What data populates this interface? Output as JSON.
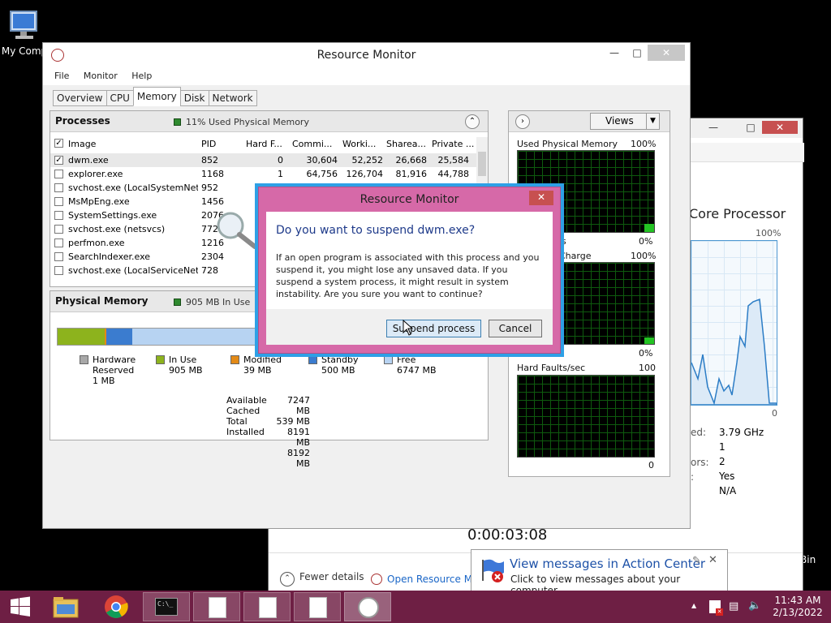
{
  "desktop": {
    "computer_icon_label": "My Comp",
    "bin_label": "Bin"
  },
  "task_manager": {
    "heading": "Core Processor",
    "graph_max": "100%",
    "graph_min": "0",
    "stats_labels": [
      "ed:",
      "ors:",
      ":",
      ""
    ],
    "stats_values": [
      "3.79 GHz",
      "1",
      "2",
      "Yes",
      "N/A"
    ],
    "uptime": "0:00:03:08",
    "fewer_details": "Fewer details",
    "open_resmon": "Open Resource Mo"
  },
  "resource_monitor": {
    "title": "Resource Monitor",
    "menu": [
      "File",
      "Monitor",
      "Help"
    ],
    "tabs": [
      "Overview",
      "CPU",
      "Memory",
      "Disk",
      "Network"
    ],
    "active_tab": "Memory",
    "processes": {
      "title": "Processes",
      "status": "11% Used Physical Memory",
      "columns": [
        "Image",
        "PID",
        "Hard F...",
        "Commi...",
        "Worki...",
        "Sharea...",
        "Private ..."
      ],
      "rows": [
        {
          "checked": true,
          "image": "dwm.exe",
          "pid": "852",
          "hard": "0",
          "commit": "30,604",
          "working": "52,252",
          "shareable": "26,668",
          "private": "25,584"
        },
        {
          "checked": false,
          "image": "explorer.exe",
          "pid": "1168",
          "hard": "1",
          "commit": "64,756",
          "working": "126,704",
          "shareable": "81,916",
          "private": "44,788"
        },
        {
          "checked": false,
          "image": "svchost.exe (LocalSystemNet...",
          "pid": "952"
        },
        {
          "checked": false,
          "image": "MsMpEng.exe",
          "pid": "1456"
        },
        {
          "checked": false,
          "image": "SystemSettings.exe",
          "pid": "2076"
        },
        {
          "checked": false,
          "image": "svchost.exe (netsvcs)",
          "pid": "772"
        },
        {
          "checked": false,
          "image": "perfmon.exe",
          "pid": "1216"
        },
        {
          "checked": false,
          "image": "SearchIndexer.exe",
          "pid": "2304"
        },
        {
          "checked": false,
          "image": "svchost.exe (LocalServiceNet...",
          "pid": "728"
        }
      ]
    },
    "physical_memory": {
      "title": "Physical Memory",
      "status": "905 MB In Use",
      "legend": [
        {
          "label": "Hardware",
          "label2": "Reserved",
          "value": "1 MB",
          "color": "#a8a8a8"
        },
        {
          "label": "In Use",
          "value": "905 MB",
          "color": "#8db31d"
        },
        {
          "label": "Modified",
          "value": "39 MB",
          "color": "#e38a16"
        },
        {
          "label": "Standby",
          "value": "500 MB",
          "color": "#3b7ccf"
        },
        {
          "label": "Free",
          "value": "6747 MB",
          "color": "#b7d3f2"
        }
      ],
      "totals_labels": [
        "Available",
        "Cached",
        "Total",
        "Installed"
      ],
      "totals_values": [
        "7247 MB",
        "539 MB",
        "8191 MB",
        "8192 MB"
      ]
    },
    "right_panel": {
      "views_label": "Views",
      "graphs": [
        {
          "title": "Used Physical Memory",
          "max": "100%",
          "min": "0%"
        },
        {
          "title": "Charge",
          "title_prefix": "ls",
          "max": "100%",
          "min": "0%"
        },
        {
          "title": "Hard Faults/sec",
          "max": "100",
          "min": "0"
        }
      ]
    }
  },
  "dialog": {
    "title": "Resource Monitor",
    "question": "Do you want to suspend dwm.exe?",
    "message": "If an open program is associated with this process and you suspend it, you might lose any unsaved data. If you suspend a system process, it might result in system instability. Are you sure you want to continue?",
    "suspend_label": "Suspend process",
    "cancel_label": "Cancel"
  },
  "notification": {
    "title": "View messages in Action Center",
    "body": "Click to view messages about your computer."
  },
  "taskbar": {
    "time": "11:43 AM",
    "date": "2/13/2022"
  },
  "colors": {
    "taskbar": "#6e1f44",
    "dialog_frame": "#d669a8",
    "dialog_title": "#1e3a8a"
  }
}
